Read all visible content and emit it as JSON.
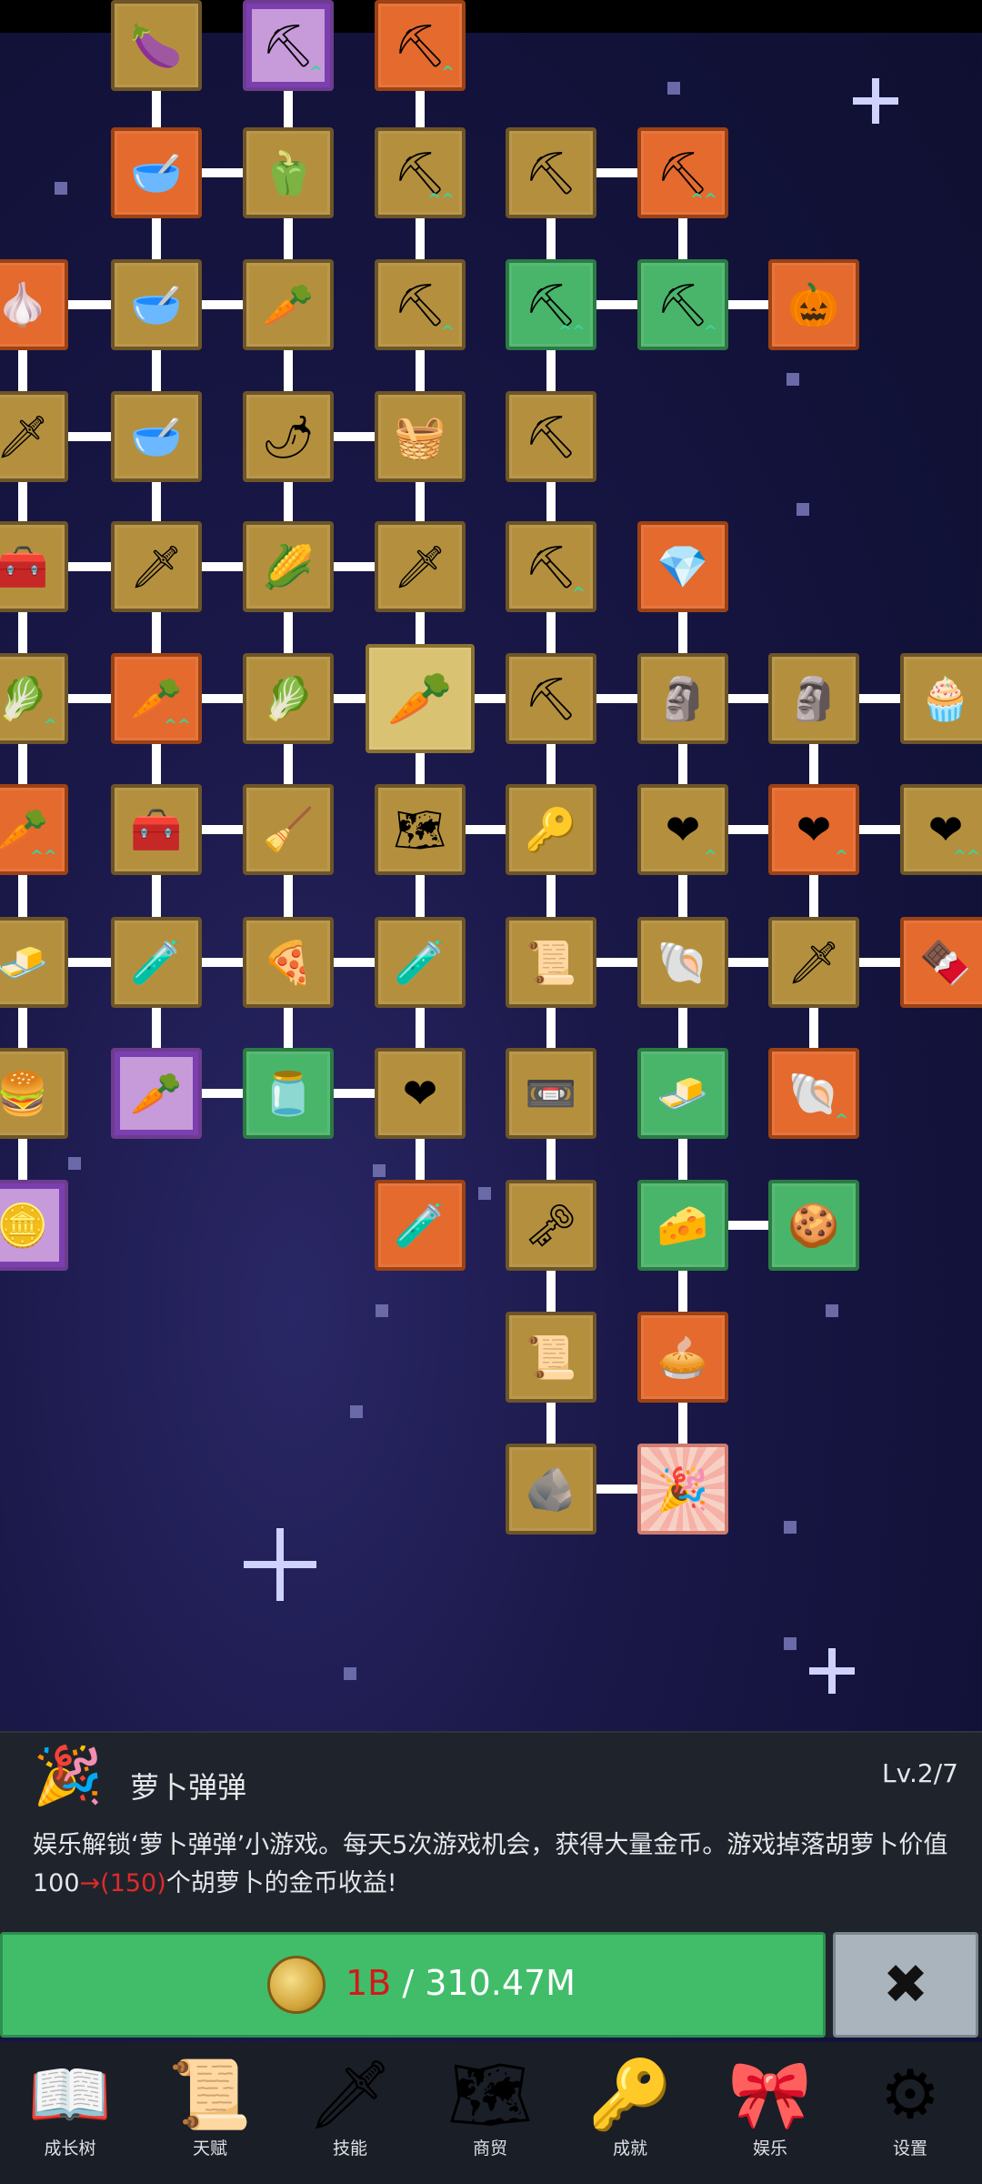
{
  "panel": {
    "icon": "confetti-icon",
    "title": "萝卜弹弹",
    "level": "Lv.2/7",
    "desc_main": "娱乐解锁‘萝卜弹弹’小游戏。每天5次游戏机会，获得大量金币。游戏掉落胡萝卜价值100",
    "desc_arrow": "→",
    "desc_next": "(150)",
    "desc_tail": "个胡萝卜的金币收益!"
  },
  "upgrade": {
    "cost_need": "1B",
    "cost_sep": " / ",
    "cost_have": "310.47M",
    "close_label": "✖"
  },
  "nav": [
    {
      "label": "成长树",
      "icon": "book-icon",
      "glyph": "📖"
    },
    {
      "label": "天赋",
      "icon": "scroll-icon",
      "glyph": "📜"
    },
    {
      "label": "技能",
      "icon": "sword-icon",
      "glyph": "🗡"
    },
    {
      "label": "商贸",
      "icon": "map-icon",
      "glyph": "🗺"
    },
    {
      "label": "成就",
      "icon": "key-icon",
      "glyph": "🔑"
    },
    {
      "label": "娱乐",
      "icon": "ribbon-icon",
      "glyph": "🎀"
    },
    {
      "label": "设置",
      "icon": "gear-icon",
      "glyph": "⚙"
    }
  ],
  "tree_nodes": [
    {
      "id": "n1",
      "icon": "eggplant-icon",
      "glyph": "🍆",
      "color": "tan"
    },
    {
      "id": "n2",
      "icon": "shovel-icon",
      "glyph": "⛏",
      "color": "purple",
      "up": "^"
    },
    {
      "id": "n3",
      "icon": "pickaxe-icon",
      "glyph": "⛏",
      "color": "orange",
      "up": "^"
    },
    {
      "id": "n4",
      "icon": "bowl-icon",
      "glyph": "🥣",
      "color": "orange"
    },
    {
      "id": "n5",
      "icon": "pepper-icon",
      "glyph": "🫑",
      "color": "tan"
    },
    {
      "id": "n6",
      "icon": "shovel-icon",
      "glyph": "⛏",
      "color": "tan",
      "up": "^^"
    },
    {
      "id": "n7",
      "icon": "pickaxe-icon",
      "glyph": "⛏",
      "color": "tan"
    },
    {
      "id": "n8",
      "icon": "pickaxe-icon",
      "glyph": "⛏",
      "color": "orange",
      "up": "^^"
    },
    {
      "id": "n9",
      "icon": "garlic-icon",
      "glyph": "🧄",
      "color": "orange"
    },
    {
      "id": "n10",
      "icon": "bowl-icon",
      "glyph": "🥣",
      "color": "tan"
    },
    {
      "id": "n11",
      "icon": "radish-icon",
      "glyph": "🥕",
      "color": "tan"
    },
    {
      "id": "n12",
      "icon": "shovel-icon",
      "glyph": "⛏",
      "color": "tan",
      "up": "^"
    },
    {
      "id": "n13",
      "icon": "pickaxe-icon",
      "glyph": "⛏",
      "color": "green",
      "up": "^^"
    },
    {
      "id": "n14",
      "icon": "pickaxe-icon",
      "glyph": "⛏",
      "color": "green",
      "up": "^"
    },
    {
      "id": "n15",
      "icon": "scarecrow-icon",
      "glyph": "🎃",
      "color": "orange"
    },
    {
      "id": "n16",
      "icon": "sword-icon",
      "glyph": "🗡",
      "color": "tan"
    },
    {
      "id": "n17",
      "icon": "bowl-icon",
      "glyph": "🥣",
      "color": "tan"
    },
    {
      "id": "n18",
      "icon": "chili-icon",
      "glyph": "🌶",
      "color": "tan"
    },
    {
      "id": "n19",
      "icon": "basket-icon",
      "glyph": "🧺",
      "color": "tan"
    },
    {
      "id": "n20",
      "icon": "pickaxe-icon",
      "glyph": "⛏",
      "color": "tan"
    },
    {
      "id": "n21",
      "icon": "chest-icon",
      "glyph": "🧰",
      "color": "tan"
    },
    {
      "id": "n22",
      "icon": "sword-icon",
      "glyph": "🗡",
      "color": "tan"
    },
    {
      "id": "n23",
      "icon": "corn-icon",
      "glyph": "🌽",
      "color": "tan"
    },
    {
      "id": "n24",
      "icon": "spear-icon",
      "glyph": "🗡",
      "color": "tan"
    },
    {
      "id": "n25",
      "icon": "pickaxe-icon",
      "glyph": "⛏",
      "color": "tan",
      "up": "^"
    },
    {
      "id": "n26",
      "icon": "crystal-icon",
      "glyph": "💎",
      "color": "orange"
    },
    {
      "id": "n27",
      "icon": "cabbage-icon",
      "glyph": "🥬",
      "color": "tan",
      "up": "^"
    },
    {
      "id": "n28",
      "icon": "carrot-icon",
      "glyph": "🥕",
      "color": "orange",
      "up": "^^"
    },
    {
      "id": "n29",
      "icon": "cabbage-icon",
      "glyph": "🥬",
      "color": "tan"
    },
    {
      "id": "n30",
      "icon": "carrot-icon",
      "glyph": "🥕",
      "color": "selected"
    },
    {
      "id": "n31",
      "icon": "pickaxe-icon",
      "glyph": "⛏",
      "color": "tan"
    },
    {
      "id": "n32",
      "icon": "statue-icon",
      "glyph": "🗿",
      "color": "tan"
    },
    {
      "id": "n33",
      "icon": "statue-icon",
      "glyph": "🗿",
      "color": "tan"
    },
    {
      "id": "n34",
      "icon": "cupcake-icon",
      "glyph": "🧁",
      "color": "tan"
    },
    {
      "id": "n35",
      "icon": "carrot-icon",
      "glyph": "🥕",
      "color": "orange",
      "up": "^^"
    },
    {
      "id": "n36",
      "icon": "chest-icon",
      "glyph": "🧰",
      "color": "tan"
    },
    {
      "id": "n37",
      "icon": "broom-icon",
      "glyph": "🧹",
      "color": "tan"
    },
    {
      "id": "n38",
      "icon": "map-icon",
      "glyph": "🗺",
      "color": "tan"
    },
    {
      "id": "n39",
      "icon": "key-icon",
      "glyph": "🔑",
      "color": "tan"
    },
    {
      "id": "n40",
      "icon": "heart-icon",
      "glyph": "❤",
      "color": "tan",
      "up": "^"
    },
    {
      "id": "n41",
      "icon": "heart-icon",
      "glyph": "❤",
      "color": "orange",
      "up": "^"
    },
    {
      "id": "n42",
      "icon": "heart-icon",
      "glyph": "❤",
      "color": "tan",
      "up": "^^"
    },
    {
      "id": "n43",
      "icon": "gold-bar-icon",
      "glyph": "🧈",
      "color": "tan"
    },
    {
      "id": "n44",
      "icon": "potion-icon",
      "glyph": "🧪",
      "color": "tan"
    },
    {
      "id": "n45",
      "icon": "pizza-icon",
      "glyph": "🍕",
      "color": "tan"
    },
    {
      "id": "n46",
      "icon": "potion-icon",
      "glyph": "🧪",
      "color": "tan"
    },
    {
      "id": "n47",
      "icon": "scroll-icon",
      "glyph": "📜",
      "color": "tan"
    },
    {
      "id": "n48",
      "icon": "fossil-icon",
      "glyph": "🐚",
      "color": "tan"
    },
    {
      "id": "n49",
      "icon": "sword-icon",
      "glyph": "🗡",
      "color": "tan"
    },
    {
      "id": "n50",
      "icon": "chocolate-icon",
      "glyph": "🍫",
      "color": "orange"
    },
    {
      "id": "n51",
      "icon": "burger-icon",
      "glyph": "🍔",
      "color": "tan"
    },
    {
      "id": "n52",
      "icon": "carrot-crate-icon",
      "glyph": "🥕",
      "color": "purple"
    },
    {
      "id": "n53",
      "icon": "oil-bottle-icon",
      "glyph": "🫙",
      "color": "green"
    },
    {
      "id": "n54",
      "icon": "heart-icon",
      "glyph": "❤",
      "color": "tan"
    },
    {
      "id": "n55",
      "icon": "cassette-icon",
      "glyph": "📼",
      "color": "tan"
    },
    {
      "id": "n56",
      "icon": "butter-icon",
      "glyph": "🧈",
      "color": "green"
    },
    {
      "id": "n57",
      "icon": "fossil-icon",
      "glyph": "🐚",
      "color": "orange",
      "up": "^"
    },
    {
      "id": "n58",
      "icon": "coin-crate-icon",
      "glyph": "🪙",
      "color": "purple"
    },
    {
      "id": "n59",
      "icon": "potion-icon",
      "glyph": "🧪",
      "color": "orange"
    },
    {
      "id": "n60",
      "icon": "key-icon",
      "glyph": "🗝",
      "color": "tan"
    },
    {
      "id": "n61",
      "icon": "cheese-icon",
      "glyph": "🧀",
      "color": "green"
    },
    {
      "id": "n62",
      "icon": "cracker-icon",
      "glyph": "🍪",
      "color": "green"
    },
    {
      "id": "n63",
      "icon": "scroll-icon",
      "glyph": "📜",
      "color": "tan"
    },
    {
      "id": "n64",
      "icon": "pie-icon",
      "glyph": "🥧",
      "color": "orange"
    },
    {
      "id": "n65",
      "icon": "rock-icon",
      "glyph": "🪨",
      "color": "tan"
    },
    {
      "id": "n66",
      "icon": "confetti-icon",
      "glyph": "🎉",
      "color": "pink"
    }
  ]
}
